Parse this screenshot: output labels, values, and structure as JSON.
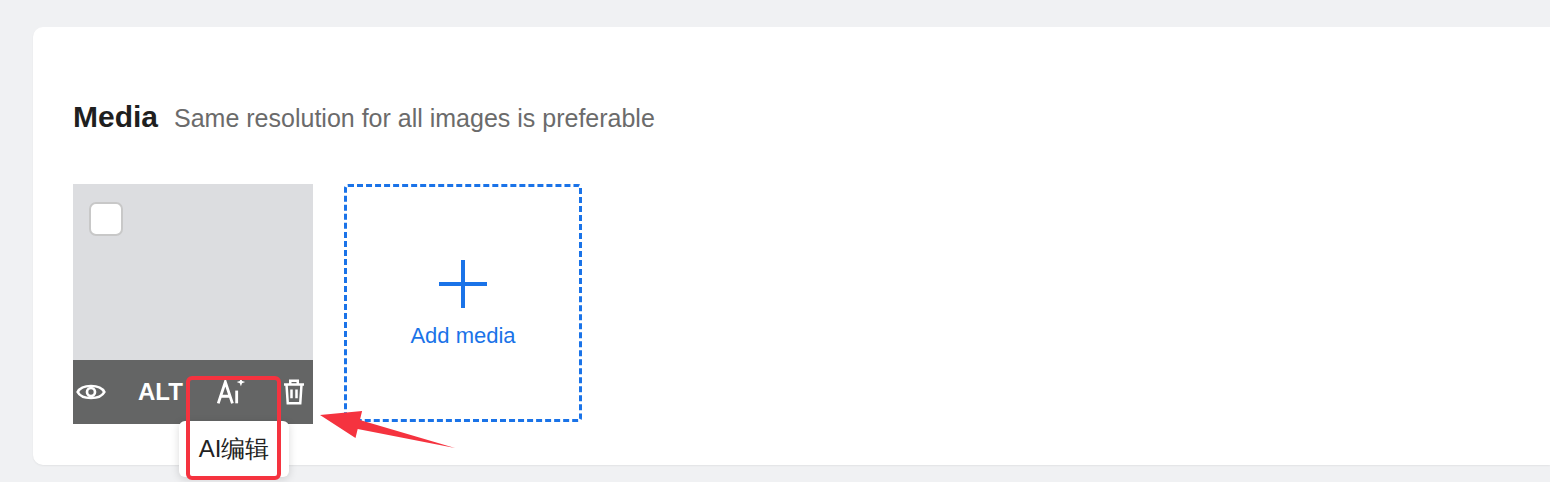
{
  "card": {
    "title": "Media",
    "hint": "Same resolution for all images is preferable"
  },
  "media": [
    {
      "checked": false,
      "alt_label": "ALT",
      "ai_hovered": true,
      "tooltip": "AI编辑"
    }
  ],
  "add_button": {
    "label": "Add media"
  }
}
